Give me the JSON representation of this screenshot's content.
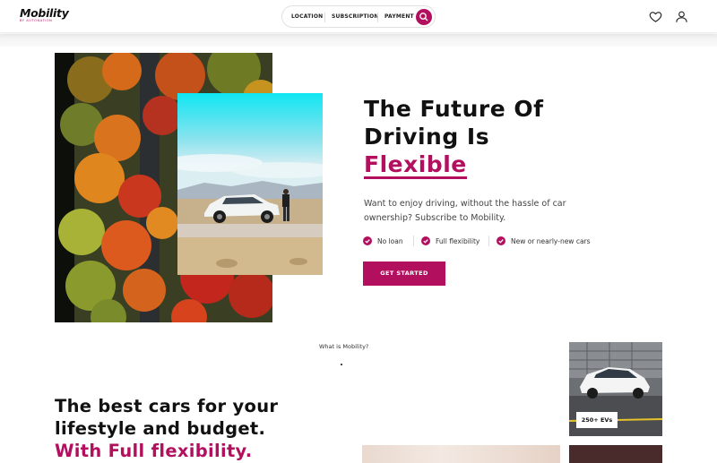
{
  "brand": {
    "name": "Mobility",
    "subtitle": "BY AUTONATION"
  },
  "nav": {
    "location": "LOCATION",
    "subscription": "SUBSCRIPTION",
    "payment": "PAYMENT"
  },
  "icons": {
    "search": "search-icon",
    "heart": "heart-icon",
    "user": "user-icon",
    "check": "check-icon"
  },
  "hero": {
    "title_line1": "The Future Of",
    "title_line2": "Driving Is",
    "title_accent": "Flexible",
    "description": "Want to enjoy driving, without the hassle of car ownership? Subscribe to Mobility.",
    "features": [
      "No loan",
      "Full flexibility",
      "New or nearly-new cars"
    ],
    "cta": "GET STARTED"
  },
  "what_is": "What is Mobility?",
  "section": {
    "line1": "The best cars for your",
    "line2": "lifestyle and budget.",
    "accent": "With Full flexibility."
  },
  "cards": {
    "ev_badge": "250+ EVs"
  },
  "colors": {
    "accent": "#b30f5f",
    "text": "#111111",
    "muted": "#444444"
  }
}
